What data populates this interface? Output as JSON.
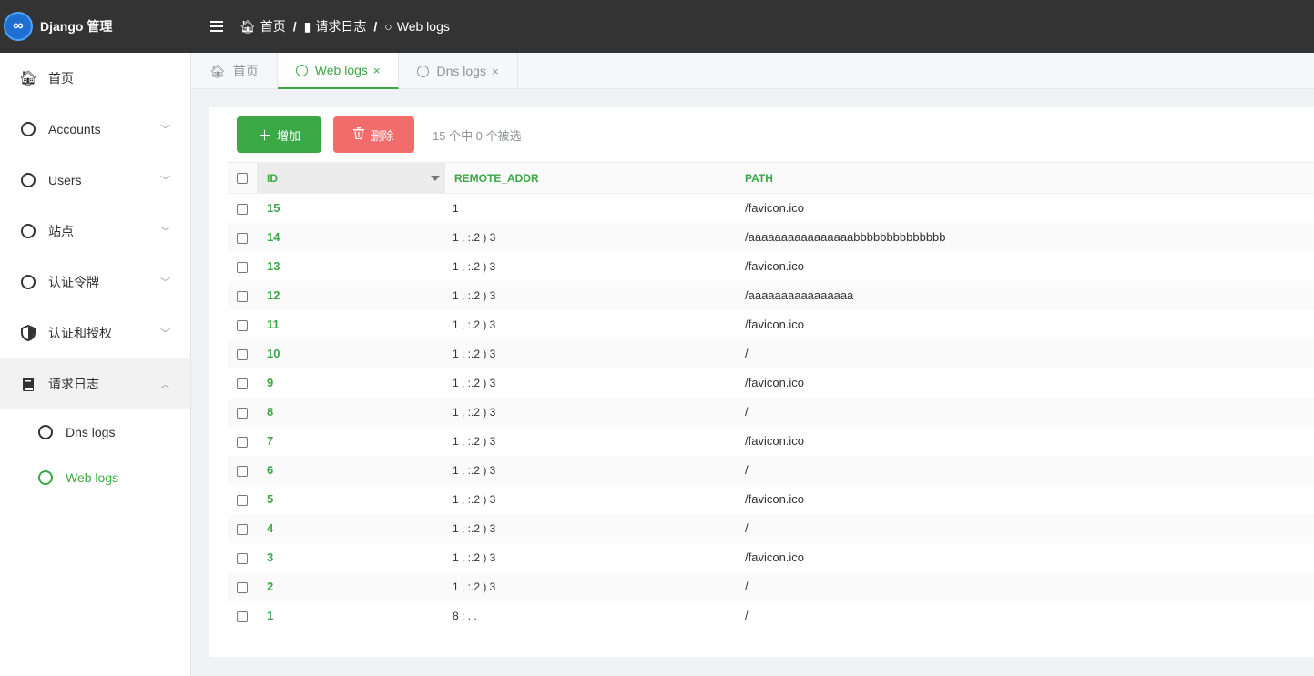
{
  "app": {
    "title": "Django 管理",
    "logo_glyph": "∞"
  },
  "breadcrumb": [
    {
      "icon": "home-icon",
      "label": "首页"
    },
    {
      "icon": "book-icon",
      "label": "请求日志"
    },
    {
      "icon": "circle-icon",
      "label": "Web logs"
    }
  ],
  "sidebar": {
    "items": [
      {
        "label": "首页",
        "icon": "home-icon",
        "chevron": ""
      },
      {
        "label": "Accounts",
        "icon": "circle-icon",
        "chevron": "﹀"
      },
      {
        "label": "Users",
        "icon": "circle-icon",
        "chevron": "﹀"
      },
      {
        "label": "站点",
        "icon": "circle-icon",
        "chevron": "﹀"
      },
      {
        "label": "认证令牌",
        "icon": "circle-icon",
        "chevron": "﹀"
      },
      {
        "label": "认证和授权",
        "icon": "shield-icon",
        "chevron": "﹀"
      },
      {
        "label": "请求日志",
        "icon": "book-icon",
        "chevron": "︿"
      }
    ],
    "submenu": [
      {
        "label": "Dns logs"
      },
      {
        "label": "Web logs"
      }
    ]
  },
  "tabs": [
    {
      "label": "首页",
      "close": ""
    },
    {
      "label": "Web logs",
      "close": "×"
    },
    {
      "label": "Dns logs",
      "close": "×"
    }
  ],
  "toolbar": {
    "add_label": "增加",
    "delete_label": "删除",
    "selection_text": "15 个中 0 个被选"
  },
  "table": {
    "headers": {
      "id": "ID",
      "remote_addr": "REMOTE_ADDR",
      "path": "PATH"
    },
    "rows": [
      {
        "id": "15",
        "addr": "1",
        "path": "/favicon.ico"
      },
      {
        "id": "14",
        "addr": "1 , :.2 ) 3",
        "path": "/aaaaaaaaaaaaaaaabbbbbbbbbbbbbb"
      },
      {
        "id": "13",
        "addr": "1 , :.2 ) 3",
        "path": "/favicon.ico"
      },
      {
        "id": "12",
        "addr": "1 , :.2 ) 3",
        "path": "/aaaaaaaaaaaaaaaa"
      },
      {
        "id": "11",
        "addr": "1 , :.2 ) 3",
        "path": "/favicon.ico"
      },
      {
        "id": "10",
        "addr": "1 , :.2 ) 3",
        "path": "/"
      },
      {
        "id": "9",
        "addr": "1 , :.2 ) 3",
        "path": "/favicon.ico"
      },
      {
        "id": "8",
        "addr": "1 , :.2 ) 3",
        "path": "/"
      },
      {
        "id": "7",
        "addr": "1 , :.2 ) 3",
        "path": "/favicon.ico"
      },
      {
        "id": "6",
        "addr": "1 , :.2 ) 3",
        "path": "/"
      },
      {
        "id": "5",
        "addr": "1 , :.2 ) 3",
        "path": "/favicon.ico"
      },
      {
        "id": "4",
        "addr": "1 , :.2 ) 3",
        "path": "/"
      },
      {
        "id": "3",
        "addr": "1 , :.2 ) 3",
        "path": "/favicon.ico"
      },
      {
        "id": "2",
        "addr": "1 , :.2 ) 3",
        "path": "/"
      },
      {
        "id": "1",
        "addr": "8 : . .",
        "path": "/"
      }
    ]
  },
  "colors": {
    "accent": "#3aa845",
    "danger": "#f36c6c",
    "topbar": "#333333"
  }
}
